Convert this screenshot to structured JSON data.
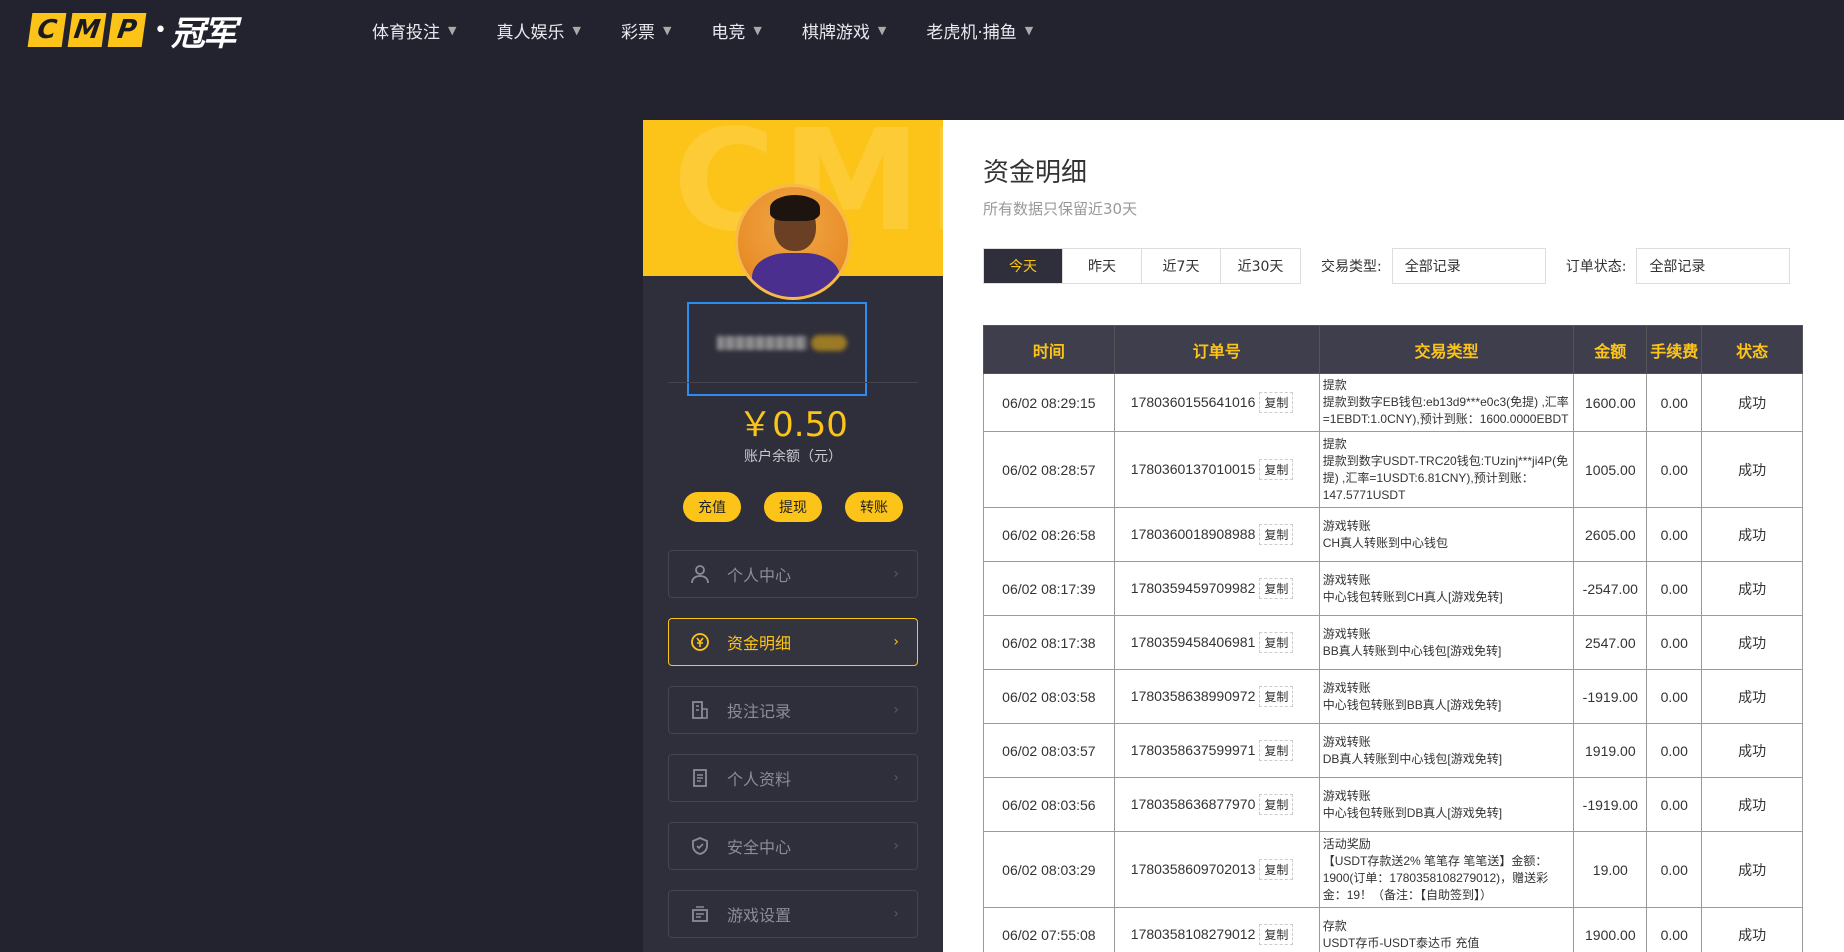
{
  "logo": {
    "letters": [
      "C",
      "M",
      "P"
    ],
    "cn": "冠军"
  },
  "nav": [
    {
      "label": "体育投注"
    },
    {
      "label": "真人娱乐"
    },
    {
      "label": "彩票"
    },
    {
      "label": "电竞"
    },
    {
      "label": "棋牌游戏"
    },
    {
      "label": "老虎机·捕鱼"
    }
  ],
  "profile": {
    "banner_text": "CMP",
    "balance": "￥0.50",
    "balance_label": "账户余额（元）",
    "actions": [
      "充值",
      "提现",
      "转账"
    ]
  },
  "menu": [
    {
      "label": "个人中心",
      "icon": "user-icon",
      "active": false
    },
    {
      "label": "资金明细",
      "icon": "funds-icon",
      "active": true
    },
    {
      "label": "投注记录",
      "icon": "bet-record-icon",
      "active": false
    },
    {
      "label": "个人资料",
      "icon": "profile-doc-icon",
      "active": false
    },
    {
      "label": "安全中心",
      "icon": "shield-icon",
      "active": false
    },
    {
      "label": "游戏设置",
      "icon": "game-settings-icon",
      "active": false
    }
  ],
  "main": {
    "title": "资金明细",
    "subtitle": "所有数据只保留近30天",
    "tabs": [
      {
        "label": "今天",
        "active": true
      },
      {
        "label": "昨天",
        "active": false
      },
      {
        "label": "近7天",
        "active": false
      },
      {
        "label": "近30天",
        "active": false
      }
    ],
    "type_label": "交易类型:",
    "type_value": "全部记录",
    "status_label": "订单状态:",
    "status_value": "全部记录",
    "copy_label": "复制"
  },
  "table": {
    "headers": [
      "时间",
      "订单号",
      "交易类型",
      "金额",
      "手续费",
      "状态"
    ],
    "rows": [
      {
        "time": "06/02 08:29:15",
        "order": "1780360155641016",
        "type": "提款",
        "detail": "提款到数字EB钱包:eb13d9***e0c3(免提) ,汇率=1EBDT:1.0CNY),预计到账：1600.0000EBDT",
        "amount": "1600.00",
        "fee": "0.00",
        "status": "成功"
      },
      {
        "time": "06/02 08:28:57",
        "order": "1780360137010015",
        "type": "提款",
        "detail": "提款到数字USDT-TRC20钱包:TUzinj***ji4P(免提) ,汇率=1USDT:6.81CNY),预计到账：147.5771USDT",
        "amount": "1005.00",
        "fee": "0.00",
        "status": "成功"
      },
      {
        "time": "06/02 08:26:58",
        "order": "1780360018908988",
        "type": "游戏转账",
        "detail": "CH真人转账到中心钱包",
        "amount": "2605.00",
        "fee": "0.00",
        "status": "成功"
      },
      {
        "time": "06/02 08:17:39",
        "order": "1780359459709982",
        "type": "游戏转账",
        "detail": "中心钱包转账到CH真人[游戏免转]",
        "amount": "-2547.00",
        "fee": "0.00",
        "status": "成功"
      },
      {
        "time": "06/02 08:17:38",
        "order": "1780359458406981",
        "type": "游戏转账",
        "detail": "BB真人转账到中心钱包[游戏免转]",
        "amount": "2547.00",
        "fee": "0.00",
        "status": "成功"
      },
      {
        "time": "06/02 08:03:58",
        "order": "1780358638990972",
        "type": "游戏转账",
        "detail": "中心钱包转账到BB真人[游戏免转]",
        "amount": "-1919.00",
        "fee": "0.00",
        "status": "成功"
      },
      {
        "time": "06/02 08:03:57",
        "order": "1780358637599971",
        "type": "游戏转账",
        "detail": "DB真人转账到中心钱包[游戏免转]",
        "amount": "1919.00",
        "fee": "0.00",
        "status": "成功"
      },
      {
        "time": "06/02 08:03:56",
        "order": "1780358636877970",
        "type": "游戏转账",
        "detail": "中心钱包转账到DB真人[游戏免转]",
        "amount": "-1919.00",
        "fee": "0.00",
        "status": "成功"
      },
      {
        "time": "06/02 08:03:29",
        "order": "1780358609702013",
        "type": "活动奖励",
        "detail": "【USDT存款送2% 笔笔存 笔笔送】金额：1900(订单：1780358108279012)，赠送彩金：19！（备注：【自助签到】）",
        "amount": "19.00",
        "fee": "0.00",
        "status": "成功"
      },
      {
        "time": "06/02 07:55:08",
        "order": "1780358108279012",
        "type": "存款",
        "detail": "USDT存币-USDT泰达币 充值",
        "amount": "1900.00",
        "fee": "0.00",
        "status": "成功"
      }
    ]
  }
}
